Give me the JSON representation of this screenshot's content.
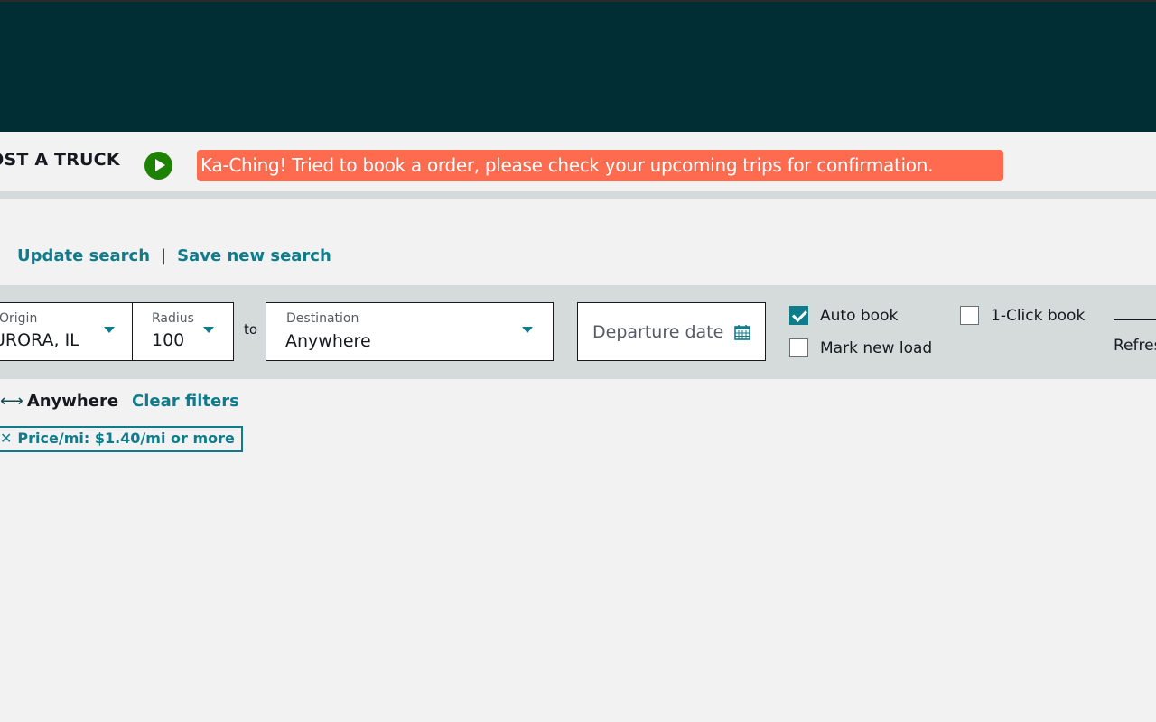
{
  "nav": {
    "title": "POST A TRUCK",
    "play_icon": "play-circle-icon"
  },
  "banner": {
    "message": "Ka-Ching! Tried to book a order, please check your upcoming trips for confirmation.",
    "color": "#ff6b4f"
  },
  "search_links": {
    "update": "Update search",
    "separator": "|",
    "save": "Save new search"
  },
  "filters": {
    "origin": {
      "label": "Origin",
      "value": "AURORA, IL"
    },
    "radius": {
      "label": "Radius",
      "value": "100"
    },
    "to_label": "to",
    "destination": {
      "label": "Destination",
      "value": "Anywhere"
    },
    "departure": {
      "placeholder": "Departure date",
      "icon": "calendar-icon"
    },
    "auto_book": {
      "label": "Auto book",
      "checked": true
    },
    "mark_new_load": {
      "label": "Mark new load",
      "checked": false
    },
    "one_click_book": {
      "label": "1-Click book",
      "checked": false
    },
    "refresh": {
      "label": "Refresh"
    }
  },
  "summary": {
    "arrow": "⟷",
    "route": "Anywhere",
    "clear_filters": "Clear filters",
    "chips": [
      {
        "close": "✕",
        "label": "Price/mi: $1.40/mi or more"
      }
    ]
  },
  "colors": {
    "header_bg": "#002e35",
    "accent": "#0f7c8c",
    "success": "#1d8102",
    "filter_bar_bg": "#d5dbdb"
  }
}
